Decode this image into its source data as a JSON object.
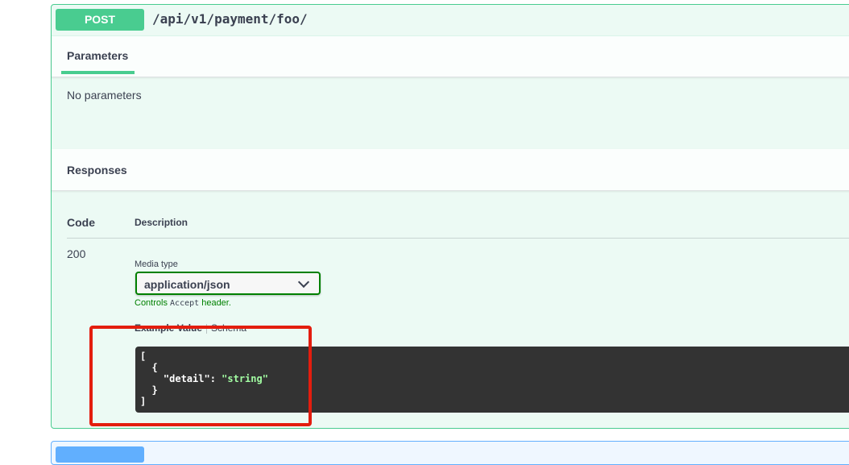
{
  "operation": {
    "method": "POST",
    "path": "/api/v1/payment/foo/"
  },
  "parameters": {
    "tab_label": "Parameters",
    "empty_text": "No parameters"
  },
  "responses": {
    "title": "Responses",
    "columns": {
      "code": "Code",
      "description": "Description"
    },
    "rows": [
      {
        "code": "200",
        "media_type_label": "Media type",
        "media_type_value": "application/json",
        "controls_prefix": "Controls ",
        "controls_code": "Accept",
        "controls_suffix": " header.",
        "example_tab": "Example Value",
        "schema_tab": "Schema",
        "example_lines": {
          "l1": "[",
          "l2": "  {",
          "l3_key": "\"detail\"",
          "l3_colon": ": ",
          "l3_value": "\"string\"",
          "l4": "  }",
          "l5": "]"
        }
      }
    ]
  },
  "colors": {
    "post": "#49cc90",
    "get": "#61affe",
    "highlight": "#e31d0e",
    "codeblock_bg": "#333333",
    "string": "#a2fca2"
  }
}
